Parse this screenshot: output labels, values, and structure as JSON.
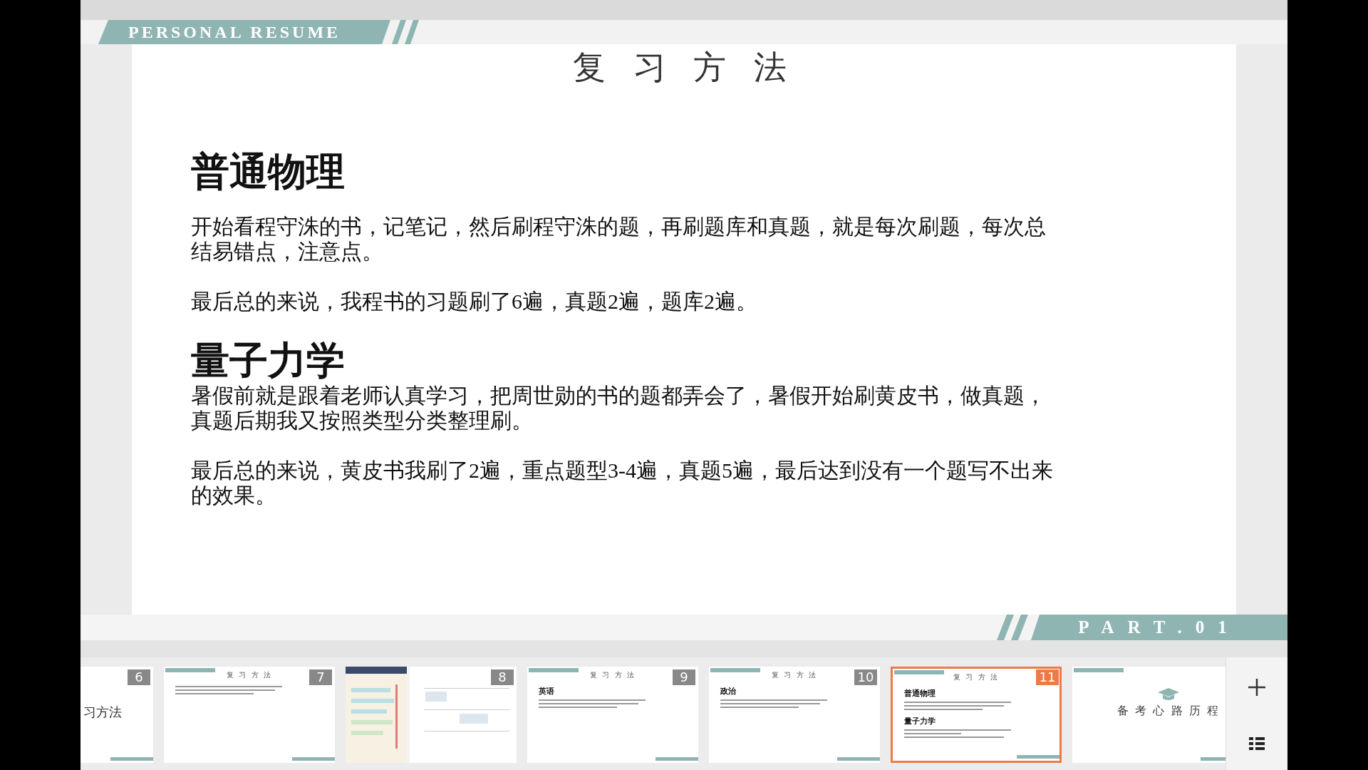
{
  "slide": {
    "banner": "PERSONAL RESUME",
    "title": "复 习 方 法",
    "sections": [
      {
        "heading": "普通物理",
        "paragraphs": [
          "开始看程守洙的书，记笔记，然后刷程守洙的题，再刷题库和真题，就是每次刷题，每次总结易错点，注意点。",
          "最后总的来说，我程书的习题刷了6遍，真题2遍，题库2遍。"
        ]
      },
      {
        "heading": "量子力学",
        "paragraphs": [
          "暑假前就是跟着老师认真学习，把周世勋的书的题都弄会了，暑假开始刷黄皮书，做真题，真题后期我又按照类型分类整理刷。",
          "最后总的来说，黄皮书我刷了2遍，重点题型3-4遍，真题5遍，最后达到没有一个题写不出来的效果。"
        ]
      }
    ],
    "footer": "PART.01"
  },
  "thumbnails": [
    {
      "number": "6",
      "kind": "closing",
      "text": "习方法",
      "selected": false
    },
    {
      "number": "7",
      "kind": "text",
      "title": "复 习 方 法",
      "selected": false
    },
    {
      "number": "8",
      "kind": "picture",
      "selected": false
    },
    {
      "number": "9",
      "kind": "text",
      "title": "复 习 方 法",
      "heading": "英语",
      "selected": false
    },
    {
      "number": "10",
      "kind": "text",
      "title": "复 习 方 法",
      "heading": "政治",
      "selected": false
    },
    {
      "number": "11",
      "kind": "text",
      "title": "复 习 方 法",
      "heading": "普通物理",
      "heading2": "量子力学",
      "selected": true
    },
    {
      "kind": "cover",
      "text": "备 考 心 路 历 程",
      "selected": false
    }
  ]
}
